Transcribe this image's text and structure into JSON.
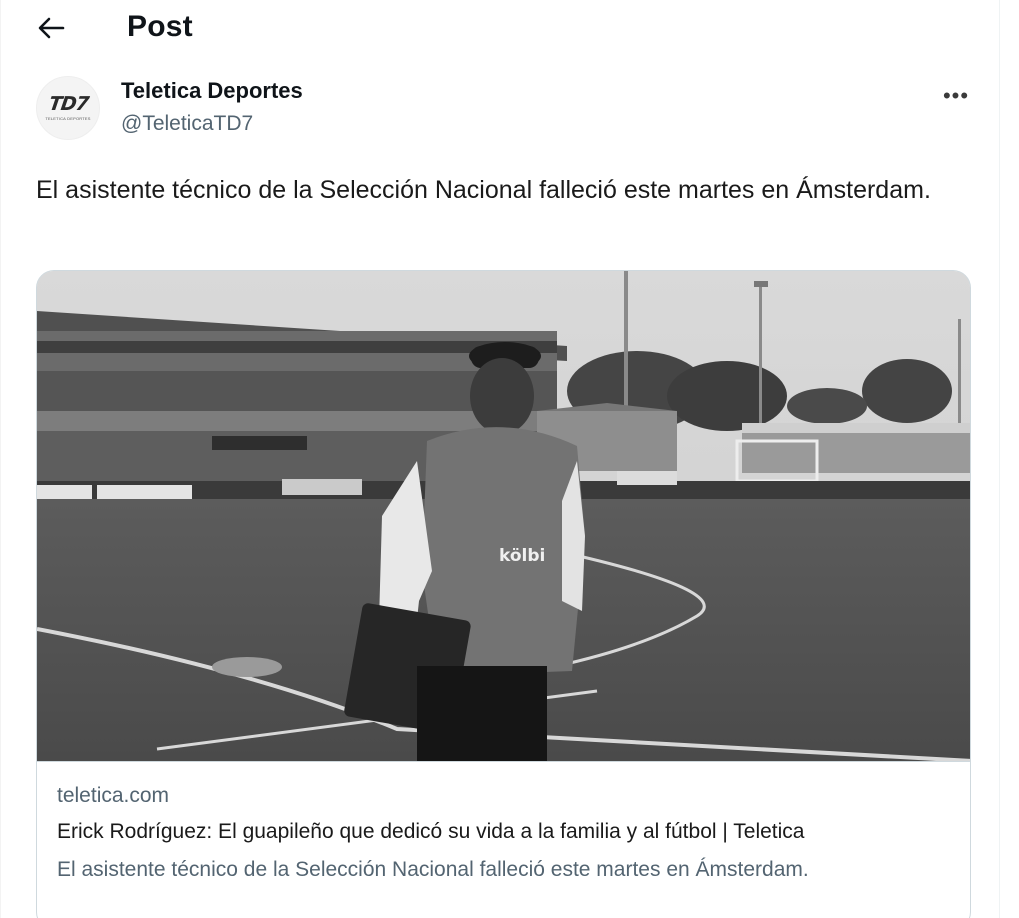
{
  "header": {
    "title": "Post",
    "back_icon": "arrow-left-icon"
  },
  "author": {
    "display_name": "Teletica Deportes",
    "handle": "@TeleticaTD7",
    "avatar_logo_text": "TD7",
    "avatar_logo_subtext": "TELETICA DEPORTES",
    "more_icon": "more-horizontal-icon",
    "more_label": "•••"
  },
  "post": {
    "text": "El asistente técnico de la Selección Nacional falleció este martes en Ámsterdam."
  },
  "link_card": {
    "image_alt": "Man in training shirt standing on a football pitch in a stadium (black and white)",
    "domain": "teletica.com",
    "title": "Erick Rodríguez: El guapileño que dedicó su vida a la familia y al fútbol | Teletica",
    "description": "El asistente técnico de la Selección Nacional falleció este martes en Ámsterdam."
  },
  "colors": {
    "text_primary": "#0f1419",
    "text_secondary": "#536471",
    "border": "#cfd9de"
  }
}
